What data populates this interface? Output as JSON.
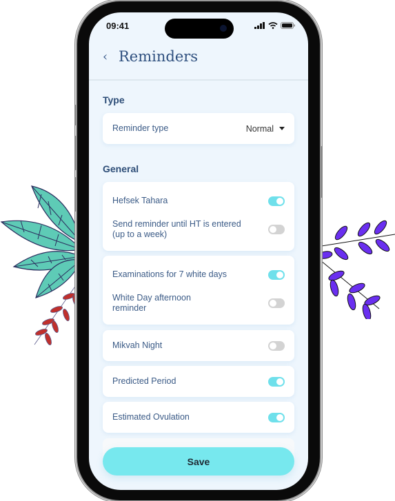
{
  "status_bar": {
    "time": "09:41",
    "icons": [
      "signal-icon",
      "wifi-icon",
      "battery-icon"
    ]
  },
  "header": {
    "back_icon": "chevron-left-icon",
    "back_glyph": "‹",
    "title": "Reminders"
  },
  "sections": {
    "type": {
      "title": "Type",
      "reminder_type": {
        "label": "Reminder type",
        "value": "Normal"
      }
    },
    "general": {
      "title": "General"
    }
  },
  "cards": [
    {
      "items": [
        {
          "label": "Hefsek Tahara",
          "enabled": true
        },
        {
          "label": "Send reminder until HT is entered (up to a week)",
          "enabled": false
        }
      ]
    },
    {
      "items": [
        {
          "label": "Examinations for 7 white days",
          "enabled": true
        },
        {
          "label": "White Day afternoon reminder",
          "enabled": false
        }
      ]
    },
    {
      "items": [
        {
          "label": "Mikvah Night",
          "enabled": false
        }
      ]
    },
    {
      "items": [
        {
          "label": "Predicted Period",
          "enabled": true
        }
      ]
    },
    {
      "items": [
        {
          "label": "Estimated Ovulation",
          "enabled": true
        }
      ]
    }
  ],
  "save_label": "Save",
  "colors": {
    "accent": "#77e8ee",
    "toggle_on": "#6fe0eb",
    "toggle_off": "#d3d3d3",
    "title": "#2f507f",
    "leaf_teal": "#5ecbb6",
    "leaf_red": "#c0302c",
    "leaf_purple": "#6a2ff0"
  }
}
